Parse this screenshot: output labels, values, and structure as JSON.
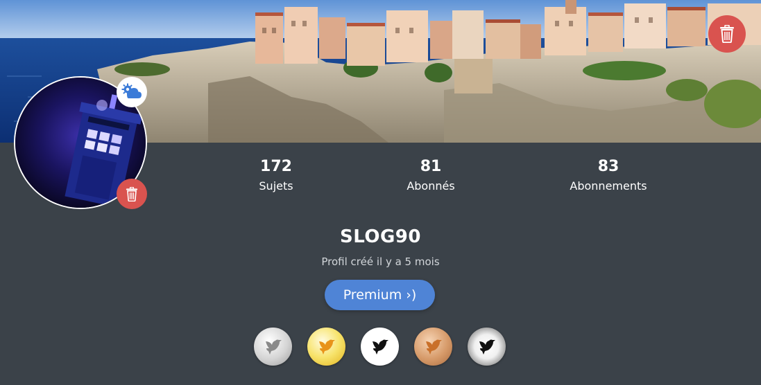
{
  "banner": {
    "image": "cliff-town-seaside-photo",
    "delete_icon": "trash-icon"
  },
  "avatar": {
    "image": "blue-police-box-photo",
    "settings_icon": "cloud-gear-icon",
    "delete_icon": "trash-icon"
  },
  "stats": {
    "subjects": {
      "count": "172",
      "label": "Sujets"
    },
    "followers": {
      "count": "81",
      "label": "Abonnés"
    },
    "following": {
      "count": "83",
      "label": "Abonnements"
    }
  },
  "profile": {
    "username": "SLOG90",
    "created": "Profil créé il y a 5 mois"
  },
  "premium": {
    "label": "Premium ›)"
  },
  "badges": [
    {
      "name": "silver-bird-badge",
      "icon": "bird-icon",
      "color": "#d4d4d4"
    },
    {
      "name": "gold-bird-badge",
      "icon": "bird-icon",
      "color": "#f7e36b"
    },
    {
      "name": "white-bird-badge",
      "icon": "bird-icon",
      "color": "#ffffff"
    },
    {
      "name": "bronze-bird-badge",
      "icon": "bird-icon",
      "color": "#d69a69"
    },
    {
      "name": "platinum-bird-badge",
      "icon": "bird-icon",
      "color": "#f0f0f0"
    }
  ],
  "colors": {
    "background": "#3b4249",
    "danger": "#d9534f",
    "premium": "#4f84d6",
    "settings_icon": "#3b7bd8"
  }
}
